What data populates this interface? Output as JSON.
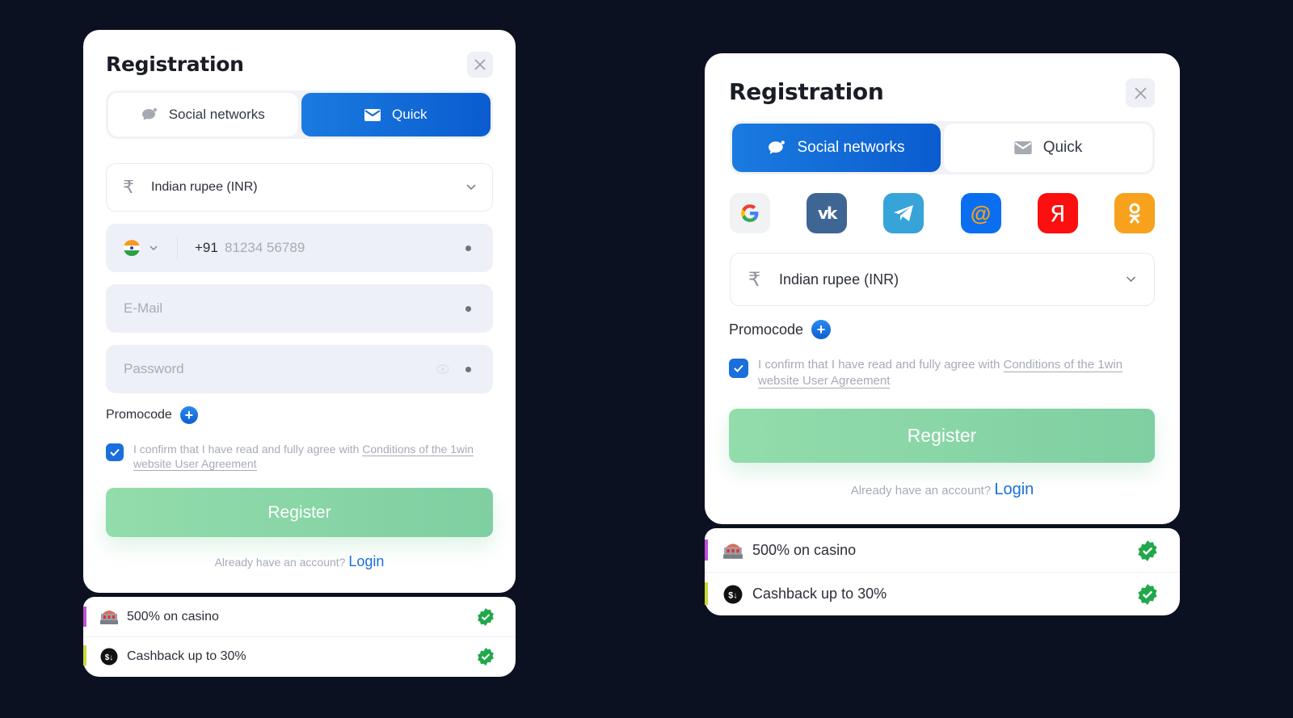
{
  "left_panel": {
    "title": "Registration",
    "tabs": [
      {
        "label": "Social networks",
        "icon": "chat-bubble-icon",
        "active": false
      },
      {
        "label": "Quick",
        "icon": "envelope-icon",
        "active": true
      }
    ],
    "currency": {
      "icon": "rupee-icon",
      "value": "Indian rupee (INR)"
    },
    "phone": {
      "country_flag": "india-flag",
      "code": "+91",
      "placeholder": "81234 56789"
    },
    "email": {
      "placeholder": "E-Mail"
    },
    "password": {
      "placeholder": "Password"
    },
    "promocode_label": "Promocode",
    "agreement": {
      "text": "I confirm that I have read and fully agree with ",
      "link": "Conditions of the 1win website User Agreement",
      "checked": true
    },
    "register_label": "Register",
    "login_prompt": "Already have an account?",
    "login_label": "Login",
    "bonuses": [
      {
        "icon": "slot-machine-icon",
        "label": "500% on casino",
        "stripe": "#c14fd6"
      },
      {
        "icon": "cashback-icon",
        "label": "Cashback up to 30%",
        "stripe": "#c9d83a"
      }
    ]
  },
  "right_panel": {
    "title": "Registration",
    "tabs": [
      {
        "label": "Social networks",
        "icon": "chat-bubble-icon",
        "active": true
      },
      {
        "label": "Quick",
        "icon": "envelope-icon",
        "active": false
      }
    ],
    "social_providers": [
      {
        "name": "Google",
        "icon": "google-icon",
        "bg": "#f1f2f4"
      },
      {
        "name": "VK",
        "icon": "vk-icon",
        "bg": "#3f6595"
      },
      {
        "name": "Telegram",
        "icon": "telegram-icon",
        "bg": "#36a3d9"
      },
      {
        "name": "Mail.ru",
        "icon": "mail-at-icon",
        "bg": "#0a6ef0"
      },
      {
        "name": "Yandex",
        "icon": "yandex-icon",
        "bg": "#fb0f0f"
      },
      {
        "name": "Odnoklassniki",
        "icon": "ok-icon",
        "bg": "#f7a11c"
      }
    ],
    "currency": {
      "icon": "rupee-icon",
      "value": "Indian rupee (INR)"
    },
    "promocode_label": "Promocode",
    "agreement": {
      "text": "I confirm that I have read and fully agree with ",
      "link": "Conditions of the 1win website User Agreement",
      "checked": true
    },
    "register_label": "Register",
    "login_prompt": "Already have an account?",
    "login_label": "Login",
    "bonuses": [
      {
        "icon": "slot-machine-icon",
        "label": "500% on casino",
        "stripe": "#c14fd6"
      },
      {
        "icon": "cashback-icon",
        "label": "Cashback up to 30%",
        "stripe": "#c9d83a"
      }
    ]
  },
  "colors": {
    "background": "#0b1120",
    "accent": "#1a6fdc",
    "register_green": "#8ad6a8",
    "badge_green": "#22a84a"
  }
}
